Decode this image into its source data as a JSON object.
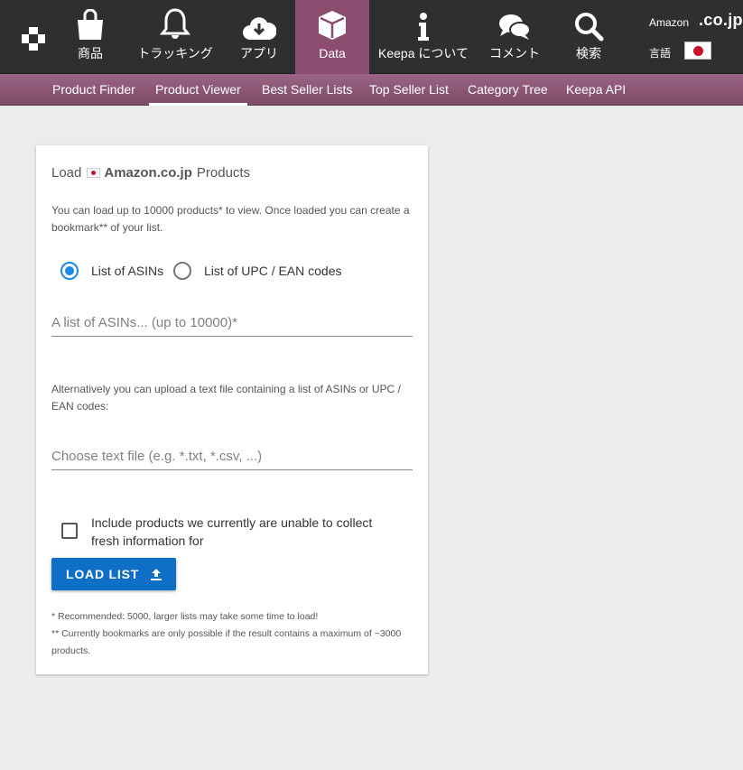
{
  "nav": {
    "items": [
      {
        "label": "商品",
        "icon": "shopping-bag-icon"
      },
      {
        "label": "トラッキング",
        "icon": "bell-icon"
      },
      {
        "label": "アプリ",
        "icon": "cloud-download-icon"
      },
      {
        "label": "Data",
        "icon": "cube-icon",
        "active": true
      },
      {
        "label": "Keepa について",
        "icon": "info-icon"
      },
      {
        "label": "コメント",
        "icon": "chat-icon"
      },
      {
        "label": "検索",
        "icon": "search-icon"
      }
    ],
    "region": {
      "amazon_label": "Amazon",
      "tld": ".co.jp",
      "language_label": "言語"
    }
  },
  "subnav": {
    "items": [
      {
        "label": "Product Finder"
      },
      {
        "label": "Product Viewer",
        "active": true
      },
      {
        "label": "Best Seller Lists"
      },
      {
        "label": "Top Seller List"
      },
      {
        "label": "Category Tree"
      },
      {
        "label": "Keepa API"
      }
    ]
  },
  "card": {
    "title_prefix": "Load",
    "title_site": "Amazon.co.jp",
    "title_suffix": "Products",
    "description": "You can load up to 10000 products* to view. Once loaded you can create a bookmark** of your list.",
    "radio_asin": "List of ASINs",
    "radio_upc": "List of UPC / EAN codes",
    "asin_placeholder": "A list of ASINs... (up to 10000)*",
    "upload_description": "Alternatively you can upload a text file containing a list of ASINs or UPC / EAN codes:",
    "file_placeholder": "Choose text file (e.g. *.txt, *.csv, ...)",
    "include_checkbox_label": "Include products we currently are unable to collect fresh information for",
    "load_button": "LOAD LIST",
    "note_1": "* Recommended: 5000, larger lists may take some time to load!",
    "note_2": "** Currently bookmarks are only possible if the result contains a maximum of ~3000 products."
  },
  "colors": {
    "topnav_bg": "#2f2f2f",
    "active_nav": "#8a4d6f",
    "subnav_bg": "#8b5676",
    "primary_button": "#0f6ec5",
    "radio_selected": "#1e88e5",
    "flag_red": "#c8102e"
  }
}
